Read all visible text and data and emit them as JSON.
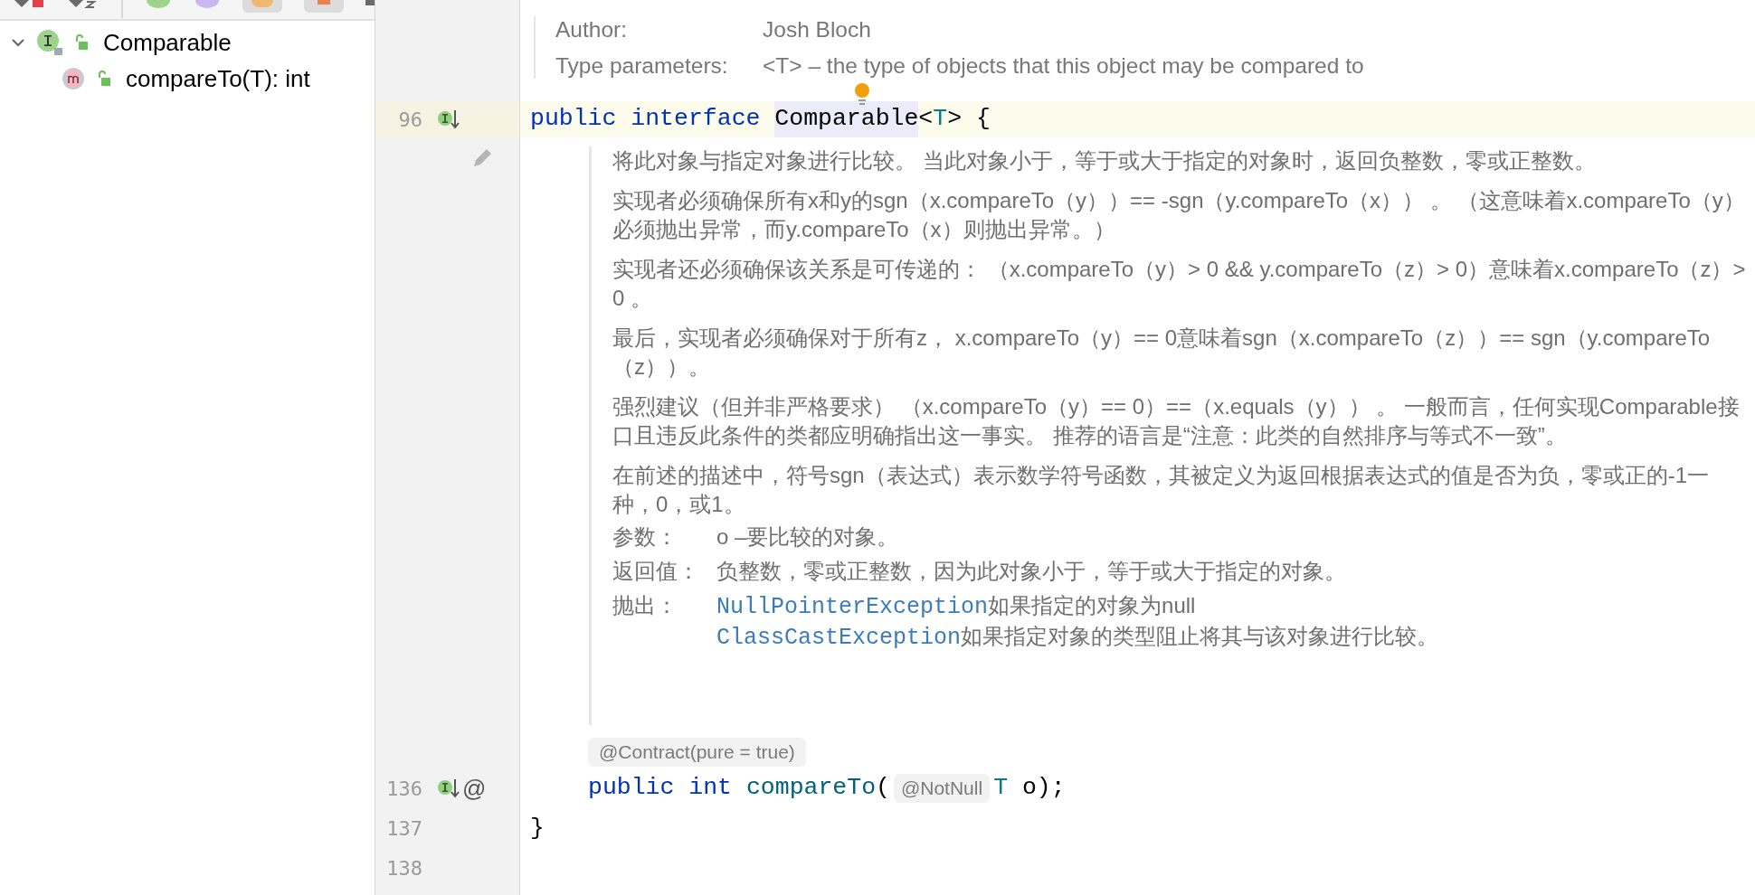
{
  "structure": {
    "items": [
      {
        "label": "Comparable",
        "kind": "interface",
        "expanded": true,
        "children": [
          {
            "label": "compareTo(T): int",
            "kind": "method"
          }
        ]
      }
    ]
  },
  "doc_header": [
    {
      "label": "Author:",
      "value": "Josh Bloch"
    },
    {
      "label": "Type parameters:",
      "value": "<T> – the type of objects that this object may be compared to"
    }
  ],
  "declaration": {
    "number": "96",
    "current": true,
    "tokens": [
      {
        "text": "public",
        "kind": "keyword",
        "spaced": true
      },
      {
        "text": "interface",
        "kind": "keyword",
        "spaced": true
      },
      {
        "text": "Comparable",
        "kind": "highlight"
      },
      {
        "text": "<",
        "kind": "plain"
      },
      {
        "text": "T",
        "kind": "type"
      },
      {
        "text": "> {",
        "kind": "plain"
      }
    ]
  },
  "doc": {
    "paragraphs": [
      "将此对象与指定对象进行比较。 当此对象小于，等于或大于指定的对象时，返回负整数，零或正整数。",
      "实现者必须确保所有x和y的sgn（x.compareTo（y））== -sgn（y.compareTo（x）） 。 （这意味着x.compareTo（y）必须抛出异常，而y.compareTo（x）则抛出异常。）",
      "实现者还必须确保该关系是可传递的： （x.compareTo（y）> 0 && y.compareTo（z）> 0）意味着x.compareTo（z）> 0 。",
      "最后，实现者必须确保对于所有z， x.compareTo（y）== 0意味着sgn（x.compareTo（z））== sgn（y.compareTo（z））。",
      "强烈建议（但并非严格要求） （x.compareTo（y）== 0）==（x.equals（y）） 。 一般而言，任何实现Comparable接口且违反此条件的类都应明确指出这一事实。 推荐的语言是“注意：此类的自然排序与等式不一致”。",
      "在前述的描述中，符号sgn（表达式）表示数学符号函数，其被定义为返回根据表达式的值是否为负，零或正的-1一种，0，或1。"
    ],
    "sections": [
      {
        "label": "参数：",
        "entries": [
          {
            "text": "o –要比较的对象。"
          }
        ]
      },
      {
        "label": "返回值：",
        "entries": [
          {
            "text": "负整数，零或正整数，因为此对象小于，等于或大于指定的对象。"
          }
        ]
      },
      {
        "label": "抛出：",
        "entries": [
          {
            "link": "NullPointerException",
            "text": "如果指定的对象为null"
          },
          {
            "link": "ClassCastException",
            "text": "如果指定对象的类型阻止将其与该对象进行比较。"
          }
        ]
      }
    ]
  },
  "method": {
    "annotation": "@Contract(pure = true)",
    "number": "136",
    "current": false,
    "gutter_mark": "@",
    "tokens": [
      {
        "text": "public",
        "kind": "keyword",
        "spaced": true
      },
      {
        "text": "int",
        "kind": "keyword",
        "spaced": true
      },
      {
        "text": "compareTo",
        "kind": "method"
      },
      {
        "text": "(",
        "kind": "plain"
      },
      {
        "text": "@NotNull",
        "kind": "inlay"
      },
      {
        "text": "T",
        "kind": "type"
      },
      {
        "text": " o);",
        "kind": "plain"
      }
    ]
  },
  "trailing_lines": [
    {
      "number": "137",
      "text": "}"
    },
    {
      "number": "138"
    }
  ]
}
